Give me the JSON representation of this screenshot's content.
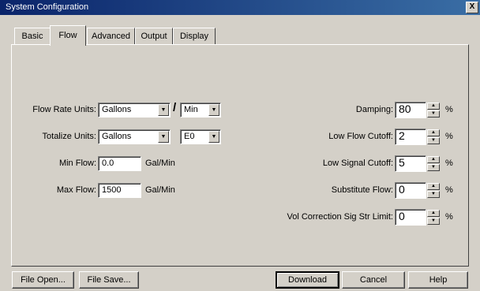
{
  "window": {
    "title": "System Configuration",
    "close_label": "X"
  },
  "tabs": [
    {
      "label": "Basic"
    },
    {
      "label": "Flow"
    },
    {
      "label": "Advanced"
    },
    {
      "label": "Output"
    },
    {
      "label": "Display"
    }
  ],
  "active_tab": "Flow",
  "left": {
    "flow_rate_units": {
      "label": "Flow Rate Units:",
      "value": "Gallons",
      "separator": "/",
      "per_value": "Min"
    },
    "totalize_units": {
      "label": "Totalize Units:",
      "value": "Gallons",
      "exponent_value": "E0"
    },
    "min_flow": {
      "label": "Min Flow:",
      "value": "0.0",
      "unit": "Gal/Min"
    },
    "max_flow": {
      "label": "Max Flow:",
      "value": "1500",
      "unit": "Gal/Min"
    }
  },
  "right": {
    "damping": {
      "label": "Damping:",
      "value": "80",
      "unit": "%"
    },
    "low_flow_cutoff": {
      "label": "Low Flow Cutoff:",
      "value": "2",
      "unit": "%"
    },
    "low_signal_cutoff": {
      "label": "Low Signal Cutoff:",
      "value": "5",
      "unit": "%"
    },
    "substitute_flow": {
      "label": "Substitute Flow:",
      "value": "0",
      "unit": "%"
    },
    "vol_correction": {
      "label": "Vol Correction Sig Str Limit:",
      "value": "0",
      "unit": "%"
    }
  },
  "buttons": {
    "file_open": "File Open...",
    "file_save": "File Save...",
    "download": "Download",
    "cancel": "Cancel",
    "help": "Help"
  },
  "icons": {
    "dropdown": "chevron-down-icon",
    "spin_up": "spin-up-icon",
    "spin_down": "spin-down-icon",
    "close": "close-icon"
  }
}
